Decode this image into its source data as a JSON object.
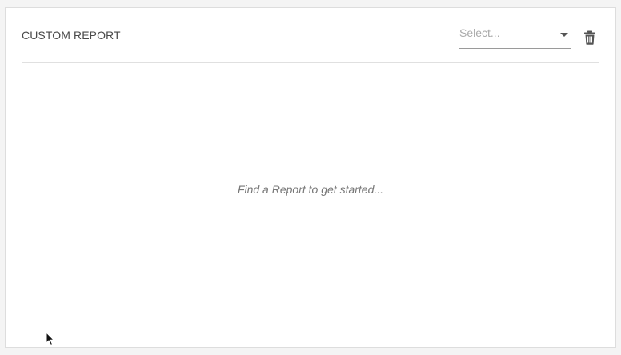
{
  "widget": {
    "title": "CUSTOM REPORT",
    "select": {
      "placeholder": "Select..."
    },
    "empty_message": "Find a Report to get started..."
  },
  "icons": {
    "delete": "trash-icon",
    "dropdown": "caret-down-icon",
    "pointer": "mouse-cursor-icon"
  },
  "colors": {
    "card_background": "#ffffff",
    "page_background": "#f4f4f4",
    "title": "#4a4a4a",
    "placeholder": "#aaaaaa",
    "empty_message": "#777777",
    "icon": "#555555"
  }
}
